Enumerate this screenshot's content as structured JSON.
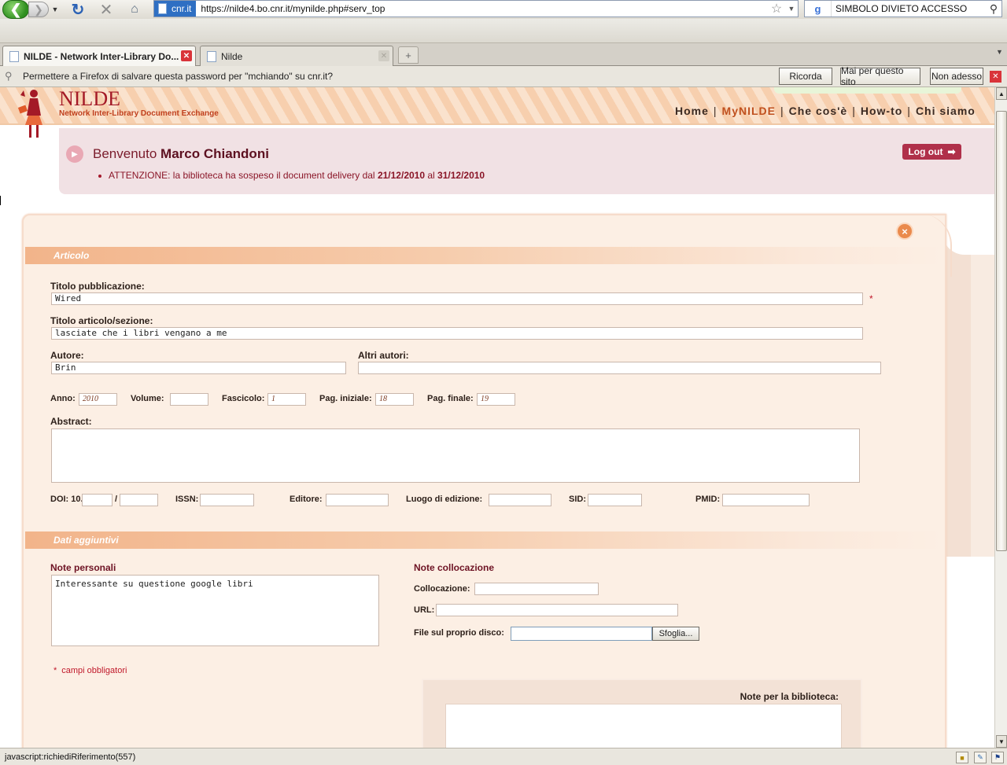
{
  "browser": {
    "site_identity": "cnr.it",
    "url": "https://nilde4.bo.cnr.it/mynilde.php#serv_top",
    "search_engine_letter": "g",
    "search_text": "SIMBOLO DIVIETO ACCESSO",
    "tabs": [
      {
        "label": "NILDE - Network Inter-Library Do...",
        "active": true
      },
      {
        "label": "Nilde",
        "active": false
      }
    ],
    "notification": {
      "text": "Permettere a Firefox di salvare questa password per \"mchiando\" su cnr.it?",
      "buttons": [
        "Ricorda",
        "Mai per questo sito",
        "Non adesso"
      ]
    },
    "status_text": "javascript:richiediRiferimento(557)"
  },
  "site": {
    "logo_title": "NILDE",
    "logo_subtitle": "Network Inter-Library Document Exchange",
    "nav": {
      "home": "Home",
      "mynilde": "MyNILDE",
      "checose": "Che cos'è",
      "howto": "How-to",
      "chisiamo": "Chi siamo",
      "separator": "|"
    },
    "welcome_prefix": "Benvenuto",
    "user_name": "Marco Chiandoni",
    "logout_label": "Log out",
    "attention": {
      "text1": "ATTENZIONE: la biblioteca ha sospeso il document delivery dal",
      "date_from": "21/12/2010",
      "text2": "al",
      "date_to": "31/12/2010"
    }
  },
  "form": {
    "section_article": "Articolo",
    "section_extra": "Dati aggiuntivi",
    "close_symbol": "×",
    "titolo_pubblicazione": {
      "label": "Titolo pubblicazione:",
      "value": "Wired",
      "required_mark": "*"
    },
    "titolo_articolo": {
      "label": "Titolo articolo/sezione:",
      "value": "lasciate che i libri vengano a me"
    },
    "autore": {
      "label": "Autore:",
      "value": "Brin"
    },
    "altri_autori": {
      "label": "Altri autori:",
      "value": ""
    },
    "anno": {
      "label": "Anno:",
      "value": "2010"
    },
    "volume": {
      "label": "Volume:",
      "value": ""
    },
    "fascicolo": {
      "label": "Fascicolo:",
      "value": "1"
    },
    "pag_iniziale": {
      "label": "Pag. iniziale:",
      "value": "18"
    },
    "pag_finale": {
      "label": "Pag. finale:",
      "value": "19"
    },
    "abstract": {
      "label": "Abstract:",
      "value": ""
    },
    "doi": {
      "label": "DOI: 10.",
      "separator": "/",
      "value1": "",
      "value2": ""
    },
    "issn": {
      "label": "ISSN:",
      "value": ""
    },
    "editore": {
      "label": "Editore:",
      "value": ""
    },
    "luogo": {
      "label": "Luogo di edizione:",
      "value": ""
    },
    "sid": {
      "label": "SID:",
      "value": ""
    },
    "pmid": {
      "label": "PMID:",
      "value": ""
    },
    "note_personali": {
      "label": "Note personali",
      "value": "Interessante su questione google libri"
    },
    "note_collocazione": {
      "label": "Note collocazione"
    },
    "collocazione": {
      "label": "Collocazione:",
      "value": ""
    },
    "url": {
      "label": "URL:",
      "value": ""
    },
    "file": {
      "label": "File sul proprio disco:",
      "value": "",
      "browse_label": "Sfoglia..."
    },
    "mandatory_note": {
      "star": "*",
      "text": "campi obbligatori"
    },
    "note_biblioteca": {
      "label": "Note per la biblioteca:",
      "value": ""
    }
  },
  "colors": {
    "accent": "#a41a27",
    "section_bar": "#f2b48a",
    "panel_bg": "#fcefe4",
    "welcome_bg": "#f1e1e4",
    "logout_bg": "#b0304a"
  }
}
